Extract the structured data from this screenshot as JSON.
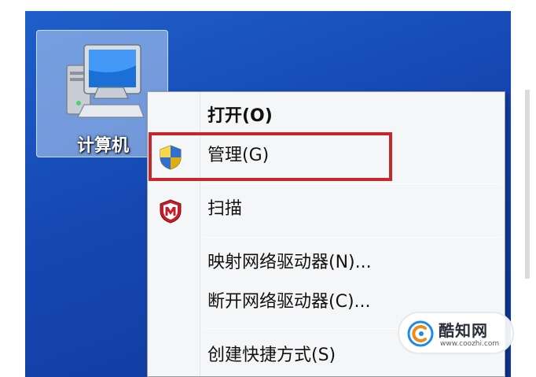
{
  "desktop": {
    "icon_label": "计算机",
    "icon_name": "computer-icon"
  },
  "context_menu": {
    "items": [
      {
        "label": "打开(O)",
        "icon": null,
        "bold": true
      },
      {
        "label": "管理(G)",
        "icon": "uac-shield-icon",
        "highlighted": true
      },
      {
        "label": "扫描",
        "icon": "mcafee-shield-icon"
      },
      {
        "label": "映射网络驱动器(N)...",
        "icon": null
      },
      {
        "label": "断开网络驱动器(C)...",
        "icon": null
      },
      {
        "label": "创建快捷方式(S)",
        "icon": null
      }
    ]
  },
  "annotation": {
    "highlight_color": "#c6262e",
    "highlight_target": "管理(G)"
  },
  "watermark": {
    "name": "酷知网",
    "url": "www.coozhi.com"
  },
  "colors": {
    "desktop_blue": "#1546b2",
    "menu_bg": "#f5f6f7",
    "highlight_red": "#c6262e"
  }
}
